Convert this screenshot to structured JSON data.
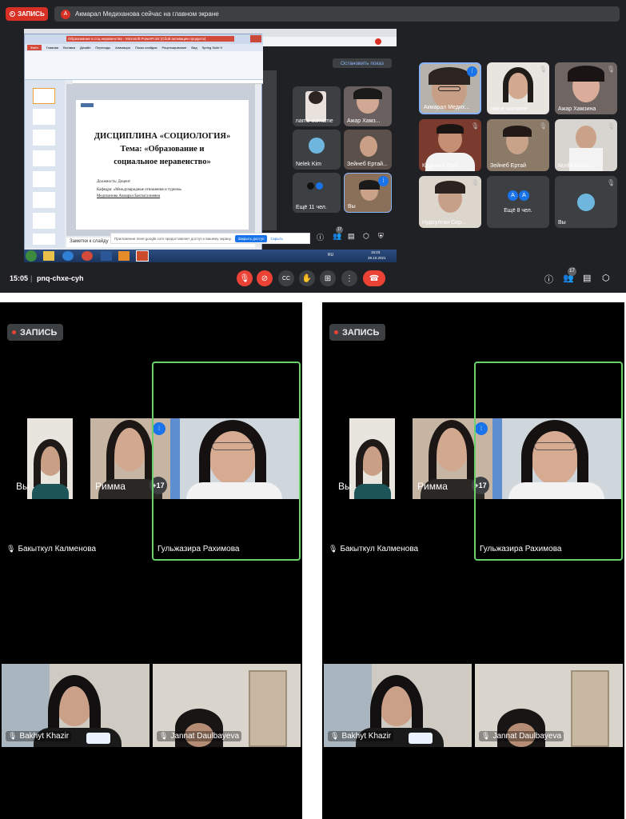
{
  "top": {
    "record_label": "ЗАПИСЬ",
    "notice_avatar": "А",
    "notice_text": "Акмарал Медиханова сейчас на главном экране",
    "stop_show_label": "Остановить показ",
    "time": "15:05",
    "meeting_code": "pnq-chxe-cyh",
    "participants_badge": "17",
    "slide": {
      "heading": "ДИСЦИПЛИНА «СОЦИОЛОГИЯ»",
      "topic_line1": "Тема: «Образование и",
      "topic_line2": "социальное неравенство»",
      "position": "Должность: Доцент",
      "department": "Кафедра: «Международные отношения и туризм»",
      "author": "Медиханова Акмарал Бактыгалиевна"
    },
    "ppt_title": "Образование и соц неравенство - Microsoft PowerPoint (Сбой активации продукта)",
    "ppt_tabs": [
      "Файл",
      "Главная",
      "Вставка",
      "Дизайн",
      "Переходы",
      "Анимация",
      "Показ слайдов",
      "Рецензирование",
      "Вид",
      "Spring Suite 9"
    ],
    "notes_label": "Заметки к слайду",
    "share_text": "Приложение meet.google.com предоставляет доступ к вашему экрану.",
    "share_close": "Закрыть доступ",
    "share_hide": "Скрыть",
    "taskbar_lang": "RU",
    "taskbar_time": "15:03",
    "taskbar_date": "29.10.2021",
    "inner_tiles": [
      {
        "name": "name surname"
      },
      {
        "name": "Ажар Хамз..."
      },
      {
        "name": "Nelek Kim"
      },
      {
        "name": "Зейнеб Ертай..."
      },
      {
        "name": "Ещё 11 чел."
      },
      {
        "name": "Вы"
      }
    ],
    "inner_badge": "17",
    "tiles": [
      {
        "name": "Акмарал Медих..."
      },
      {
        "name": "name surname"
      },
      {
        "name": "Ажар Хамзина"
      },
      {
        "name": "Кадыхан Динс..."
      },
      {
        "name": "Зейнеб Ертай"
      },
      {
        "name": "Nurila Abuze..."
      },
      {
        "name": "Нурсултан Сер..."
      },
      {
        "name": "Ещё 8 чел.",
        "letters": [
          "A",
          "A"
        ]
      },
      {
        "name": "Вы"
      }
    ]
  },
  "left": {
    "record_label": "ЗАПИСЬ",
    "you": "Вы",
    "rimma": "Римма",
    "plus": "+17",
    "main_name": "Гульжазира Рахимова",
    "muted_name": "Бакыткул Калменова",
    "bottom_left": "Bakhyt Khazir",
    "bottom_right": "Jannat Daulbayeva"
  },
  "right": {
    "record_label": "ЗАПИСЬ",
    "you": "Вы",
    "rimma": "Римма",
    "plus": "+17",
    "main_name": "Гульжазира Рахимова",
    "muted_name": "Бакыткул Калменова",
    "bottom_left": "Bakhyt Khazir",
    "bottom_right": "Jannat Daulbayeva"
  },
  "colors": {
    "meet_bg": "#202124",
    "tile_bg": "#3c4043",
    "red": "#d93025",
    "blue": "#1a73e8",
    "green_frame": "#6ad06a"
  }
}
